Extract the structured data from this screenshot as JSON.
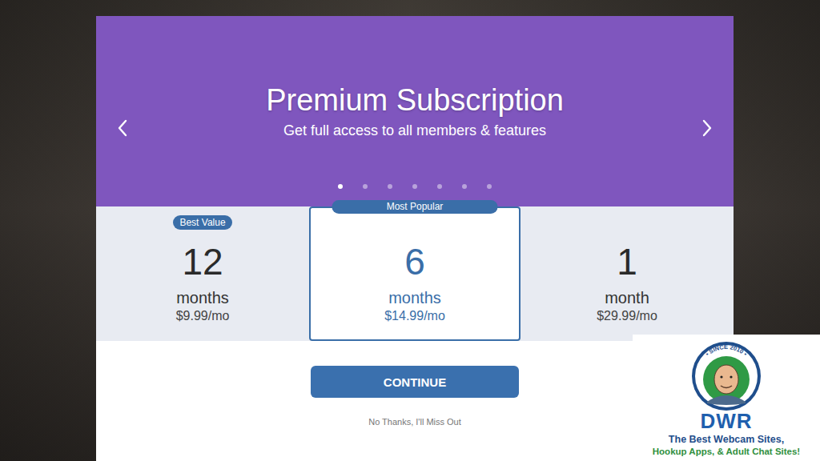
{
  "carousel": {
    "title": "Premium Subscription",
    "subtitle": "Get full access to all members & features",
    "dots": [
      {
        "selected": true
      },
      {
        "selected": false
      },
      {
        "selected": false
      },
      {
        "selected": false
      },
      {
        "selected": false
      },
      {
        "selected": false
      },
      {
        "selected": false
      }
    ]
  },
  "plans": [
    {
      "months": "12",
      "unit": "months",
      "price": "$9.99/mo",
      "badge": "Best Value",
      "selected": false
    },
    {
      "months": "6",
      "unit": "months",
      "price": "$14.99/mo",
      "badge": "Most Popular",
      "selected": true
    },
    {
      "months": "1",
      "unit": "month",
      "price": "$29.99/mo",
      "selected": false
    }
  ],
  "continue": "CONTINUE",
  "decline": "No Thanks, I'll Miss Out",
  "watermark": {
    "since": "• SINCE 2010 •",
    "brand": "DWR",
    "tagline_1": "The Best Webcam Sites,",
    "tagline_2": "Hookup Apps, & Adult Chat Sites!"
  }
}
